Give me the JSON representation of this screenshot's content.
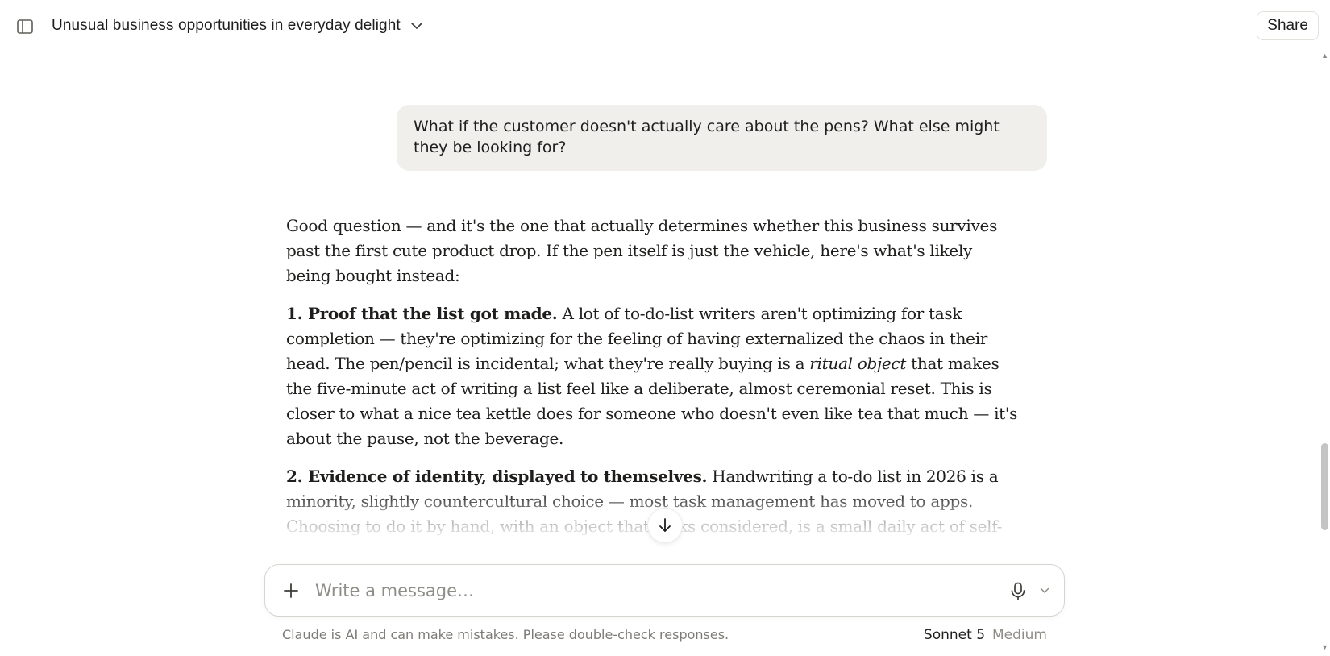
{
  "header": {
    "title": "Unusual business opportunities in everyday delight",
    "share_label": "Share",
    "icons": {
      "sidebar": "sidebar-toggle-icon",
      "chevron": "chevron-down-icon"
    }
  },
  "conversation": {
    "user_message": "What if the customer doesn't actually care about the pens? What else might they be looking for?",
    "response": {
      "intro": "Good question — and it's the one that actually determines whether this business survives past the first cute product drop. If the pen itself is just the vehicle, here's what's likely being bought instead:",
      "point1": {
        "heading": "1. Proof that the list got made.",
        "text_a": " A lot of to-do-list writers aren't optimizing for task completion — they're optimizing for the feeling of having externalized the chaos in their head. The pen/pencil is incidental; what they're really buying is a ",
        "emphasis": "ritual object",
        "text_b": " that makes the five-minute act of writing a list feel like a deliberate, almost ceremonial reset. This is closer to what a nice tea kettle does for someone who doesn't even like tea that much — it's about the pause, not the beverage."
      },
      "point2": {
        "heading": "2. Evidence of identity, displayed to themselves.",
        "text": " Handwriting a to-do list in 2026 is a minority, slightly countercultural choice — most task management has moved to apps. Choosing to do it by hand, with an object that looks considered, is a small daily act of self-definition: \"I'm not just another person pinging Slack reminders at myself.\" The customer may"
      }
    }
  },
  "composer": {
    "placeholder": "Write a message…",
    "value": ""
  },
  "footer": {
    "disclaimer": "Claude is AI and can make mistakes. Please double-check responses.",
    "model_name": "Sonnet 5",
    "model_effort": "Medium"
  },
  "colors": {
    "background": "#ffffff",
    "user_bubble": "#f0efec",
    "text": "#1f1e1d",
    "muted": "#7d7b76"
  }
}
